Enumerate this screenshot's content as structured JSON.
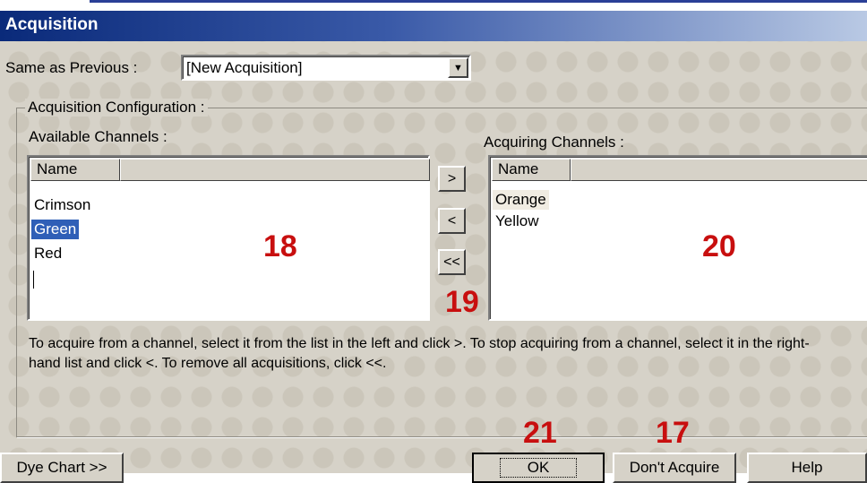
{
  "window": {
    "title": "Acquisition"
  },
  "same_as_previous": {
    "label": "Same as Previous :",
    "value": "[New Acquisition]"
  },
  "config": {
    "group_label": "Acquisition Configuration :",
    "available": {
      "label": "Available Channels :",
      "column": "Name",
      "items": [
        "Crimson",
        "Green",
        "Red"
      ],
      "selected": "Green"
    },
    "acquiring": {
      "label": "Acquiring Channels :",
      "column": "Name",
      "items": [
        "Orange",
        "Yellow"
      ]
    },
    "buttons": {
      "add": ">",
      "remove": "<",
      "remove_all": "<<"
    },
    "help_text": "To acquire from a channel, select it from the list in the left and click >. To stop acquiring from a channel, select it in the right-hand list and click <. To remove all acquisitions, click <<."
  },
  "annotations": {
    "available_list": "18",
    "move_buttons": "19",
    "acquiring_list": "20",
    "ok": "21",
    "dont_acquire": "17"
  },
  "footer": {
    "dye_chart": "Dye Chart >>",
    "ok": "OK",
    "dont_acquire": "Don't Acquire",
    "help": "Help"
  }
}
